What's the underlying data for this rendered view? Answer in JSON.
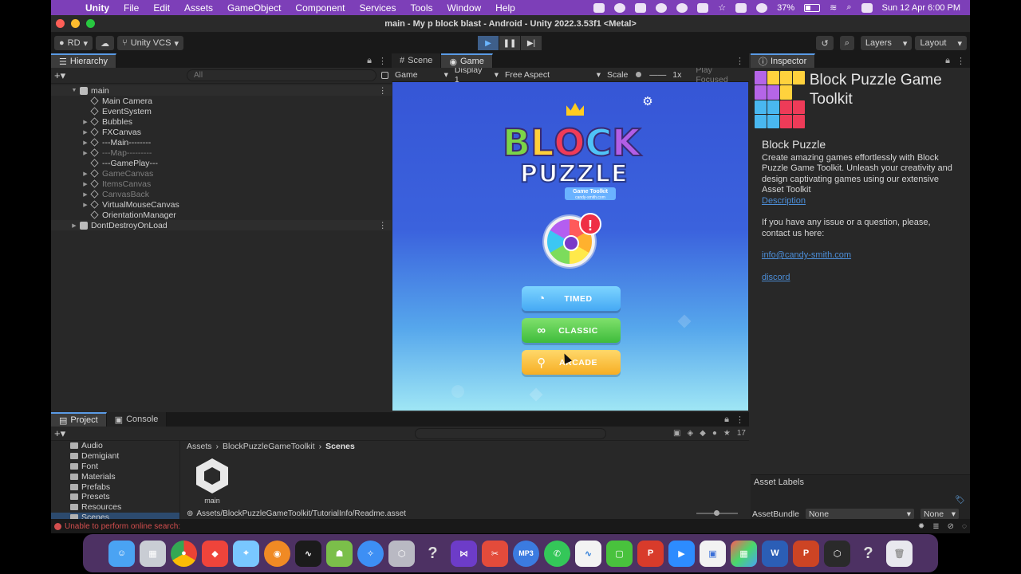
{
  "menubar": {
    "app": "Unity",
    "items": [
      "File",
      "Edit",
      "Assets",
      "GameObject",
      "Component",
      "Services",
      "Tools",
      "Window",
      "Help"
    ],
    "battery": "37%",
    "datetime": "Sun 12 Apr  6:00 PM"
  },
  "window": {
    "title": "main - My p block blast - Android - Unity 2022.3.53f1 <Metal>"
  },
  "toolbar": {
    "account": "RD",
    "vcs": "Unity VCS",
    "layers": "Layers",
    "layout": "Layout"
  },
  "hierarchy": {
    "tab": "Hierarchy",
    "search_placeholder": "All",
    "scene": "main",
    "items": [
      {
        "label": "Main Camera"
      },
      {
        "label": "EventSystem"
      },
      {
        "label": "Bubbles"
      },
      {
        "label": "FXCanvas"
      },
      {
        "label": "---Main--------"
      },
      {
        "label": "---Map---------"
      },
      {
        "label": "---GamePlay---"
      },
      {
        "label": "GameCanvas"
      },
      {
        "label": "ItemsCanvas"
      },
      {
        "label": "CanvasBack"
      },
      {
        "label": "VirtualMouseCanvas"
      },
      {
        "label": "OrientationManager"
      }
    ],
    "ddol": "DontDestroyOnLoad"
  },
  "gameview": {
    "tab_scene": "Scene",
    "tab_game": "Game",
    "mode": "Game",
    "display": "Display 1",
    "aspect": "Free Aspect",
    "scale_label": "Scale",
    "scale_value": "1x",
    "play_focused": "Play Focused",
    "logo_letters": [
      "B",
      "L",
      "O",
      "C",
      "K"
    ],
    "logo_subtitle": "PUZZLE",
    "logo_toolkit": "Game Toolkit",
    "logo_site": "candy-smith.com",
    "alert": "!",
    "buttons": {
      "timed": "TIMED",
      "classic": "CLASSIC",
      "arcade": "ARCADE"
    }
  },
  "inspector": {
    "tab": "Inspector",
    "title": "Block Puzzle Game Toolkit",
    "heading": "Block Puzzle",
    "description": "Create amazing games effortlessly with Block Puzzle Game Toolkit. Unleash your creativity and design captivating games using our extensive Asset Toolkit",
    "description_link": "Description",
    "contact_text": "If you have any issue or a question, please, contact us here:",
    "email": "info@candy-smith.com",
    "discord": "discord",
    "asset_labels": "Asset Labels",
    "asset_bundle_label": "AssetBundle",
    "asset_bundle_value": "None",
    "variant_value": "None"
  },
  "project": {
    "tab_project": "Project",
    "tab_console": "Console",
    "folders": [
      "Audio",
      "Demigiant",
      "Font",
      "Materials",
      "Prefabs",
      "Presets",
      "Resources",
      "Scenes"
    ],
    "breadcrumb": [
      "Assets",
      "BlockPuzzleGameToolkit",
      "Scenes"
    ],
    "asset_name": "main",
    "selected_path": "Assets/BlockPuzzleGameToolkit/TutorialInfo/Readme.asset",
    "count": "17"
  },
  "status": {
    "message": "Unable to perform online search:"
  },
  "dock": {
    "apps": [
      "Finder",
      "Launchpad",
      "Chrome",
      "AnyDesk",
      "Maps",
      "Blender",
      "Activity",
      "Android Studio",
      "Safari",
      "Unity Hub",
      "Help",
      "Visual Studio",
      "Remote",
      "MP3",
      "WhatsApp",
      "Freeform",
      "Clip",
      "PowerPoint Alt",
      "Zoom",
      "Preview",
      "App Store",
      "Word",
      "PowerPoint",
      "Unity",
      "Help 2",
      "Trash"
    ]
  },
  "colors": {
    "menubar_bg": "#7d3fb8",
    "accent": "#5a9be6",
    "link": "#4c8ed8",
    "error": "#d24e4e"
  }
}
